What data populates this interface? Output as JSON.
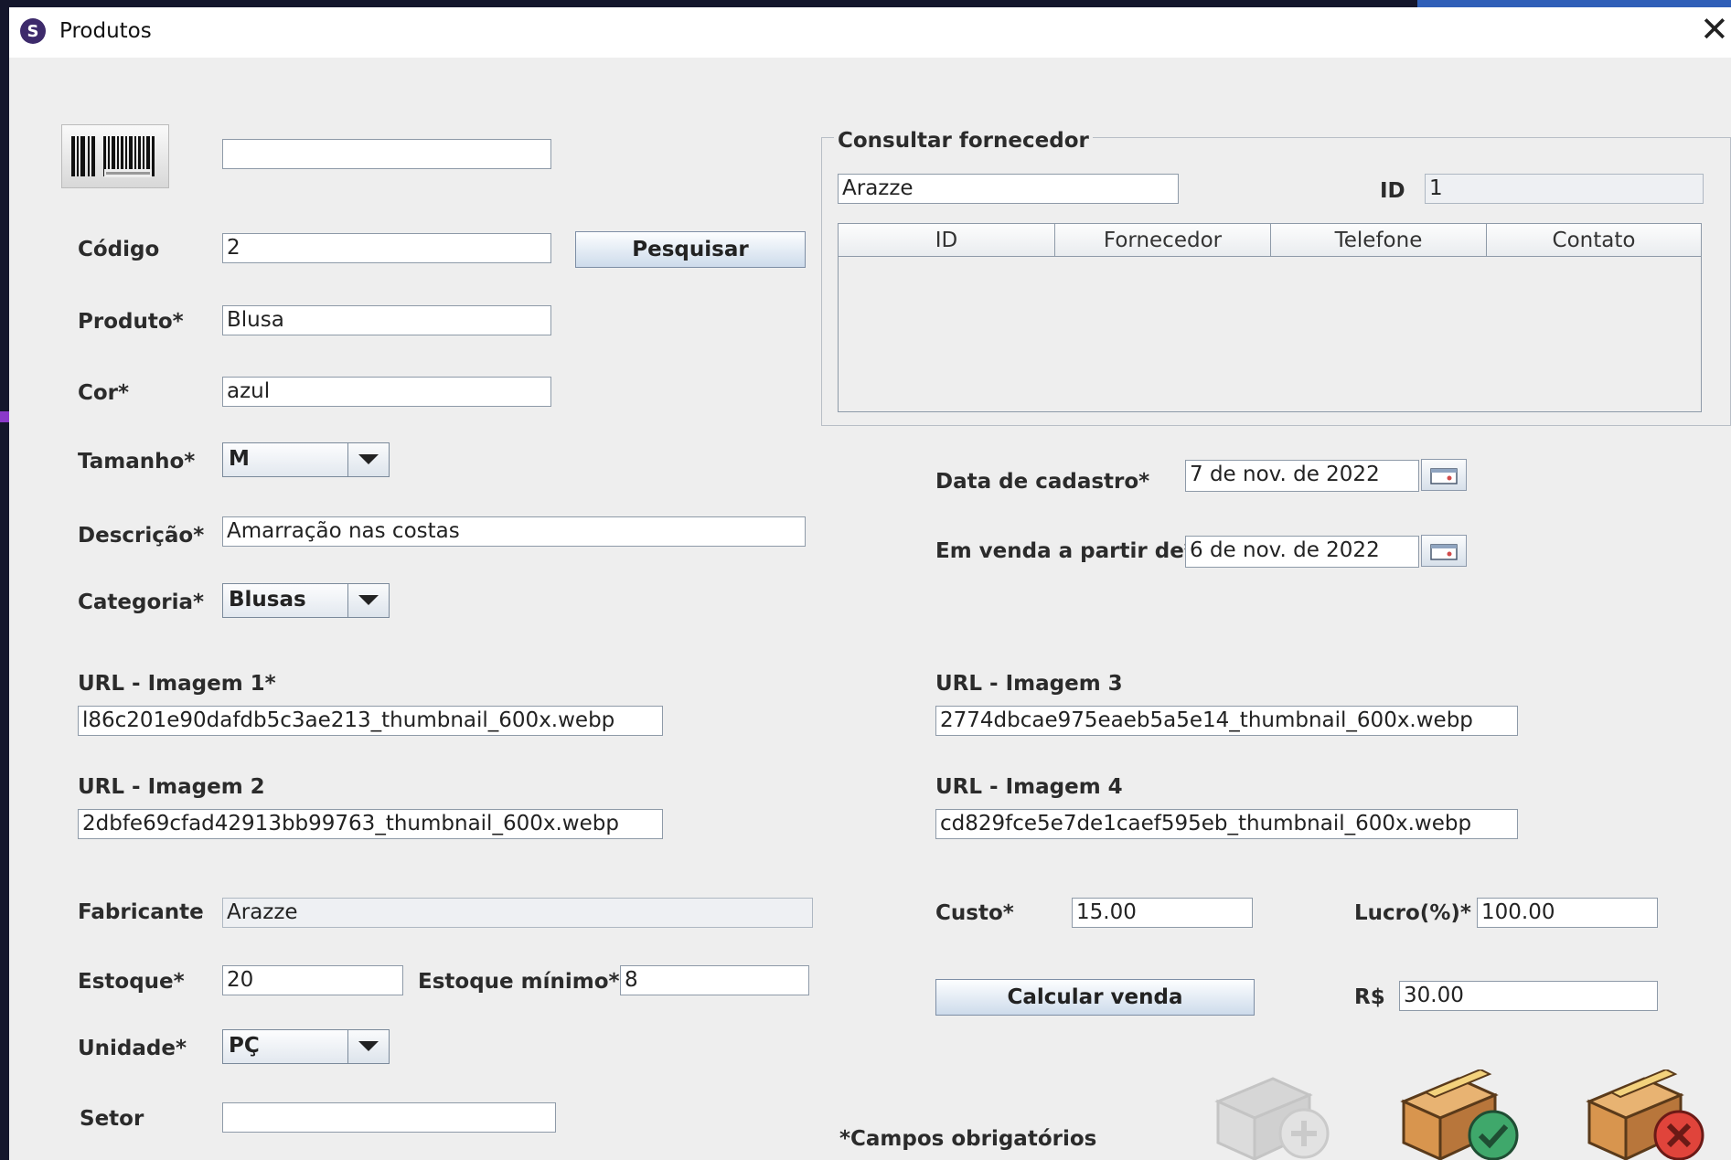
{
  "window": {
    "title": "Produtos",
    "app_icon_letter": "S"
  },
  "form": {
    "barcode_value": "",
    "codigo": {
      "label": "Código",
      "value": "2"
    },
    "pesquisar_button": "Pesquisar",
    "produto": {
      "label": "Produto*",
      "value": "Blusa"
    },
    "cor": {
      "label": "Cor*",
      "value": "azul"
    },
    "tamanho": {
      "label": "Tamanho*",
      "value": "M"
    },
    "descricao": {
      "label": "Descrição*",
      "value": "Amarração nas costas"
    },
    "categoria": {
      "label": "Categoria*",
      "value": "Blusas"
    },
    "url1": {
      "label": "URL - Imagem 1*",
      "value": "l86c201e90dafdb5c3ae213_thumbnail_600x.webp"
    },
    "url2": {
      "label": "URL - Imagem 2",
      "value": "2dbfe69cfad42913bb99763_thumbnail_600x.webp"
    },
    "url3": {
      "label": "URL - Imagem 3",
      "value": "2774dbcae975eaeb5a5e14_thumbnail_600x.webp"
    },
    "url4": {
      "label": "URL - Imagem 4",
      "value": "cd829fce5e7de1caef595eb_thumbnail_600x.webp"
    },
    "fabricante": {
      "label": "Fabricante",
      "value": "Arazze"
    },
    "estoque": {
      "label": "Estoque*",
      "value": "20"
    },
    "estoque_minimo": {
      "label": "Estoque mínimo*",
      "value": "8"
    },
    "unidade": {
      "label": "Unidade*",
      "value": "PÇ"
    },
    "setor": {
      "label": "Setor",
      "value": ""
    },
    "data_cadastro": {
      "label": "Data de cadastro*",
      "value": "7 de nov. de 2022"
    },
    "em_venda": {
      "label": "Em venda a partir de*",
      "value": "6 de nov. de 2022"
    },
    "custo": {
      "label": "Custo*",
      "value": "15.00"
    },
    "lucro": {
      "label": "Lucro(%)*",
      "value": "100.00"
    },
    "calcular_button": "Calcular venda",
    "preco": {
      "label": "R$",
      "value": "30.00"
    },
    "required_note": "*Campos obrigatórios"
  },
  "fornecedor": {
    "legend": "Consultar fornecedor",
    "search_value": "Arazze",
    "id_label": "ID",
    "id_value": "1",
    "table_headers": [
      "ID",
      "Fornecedor",
      "Telefone",
      "Contato"
    ]
  },
  "icons": {
    "barcode": "barcode-icon",
    "calendar": "calendar-icon",
    "add_product": "box-add-icon",
    "confirm": "box-check-icon",
    "cancel": "box-x-icon"
  },
  "colors": {
    "check": "#3fa86b",
    "cancel": "#e0443b",
    "box": "#c98a4a"
  }
}
